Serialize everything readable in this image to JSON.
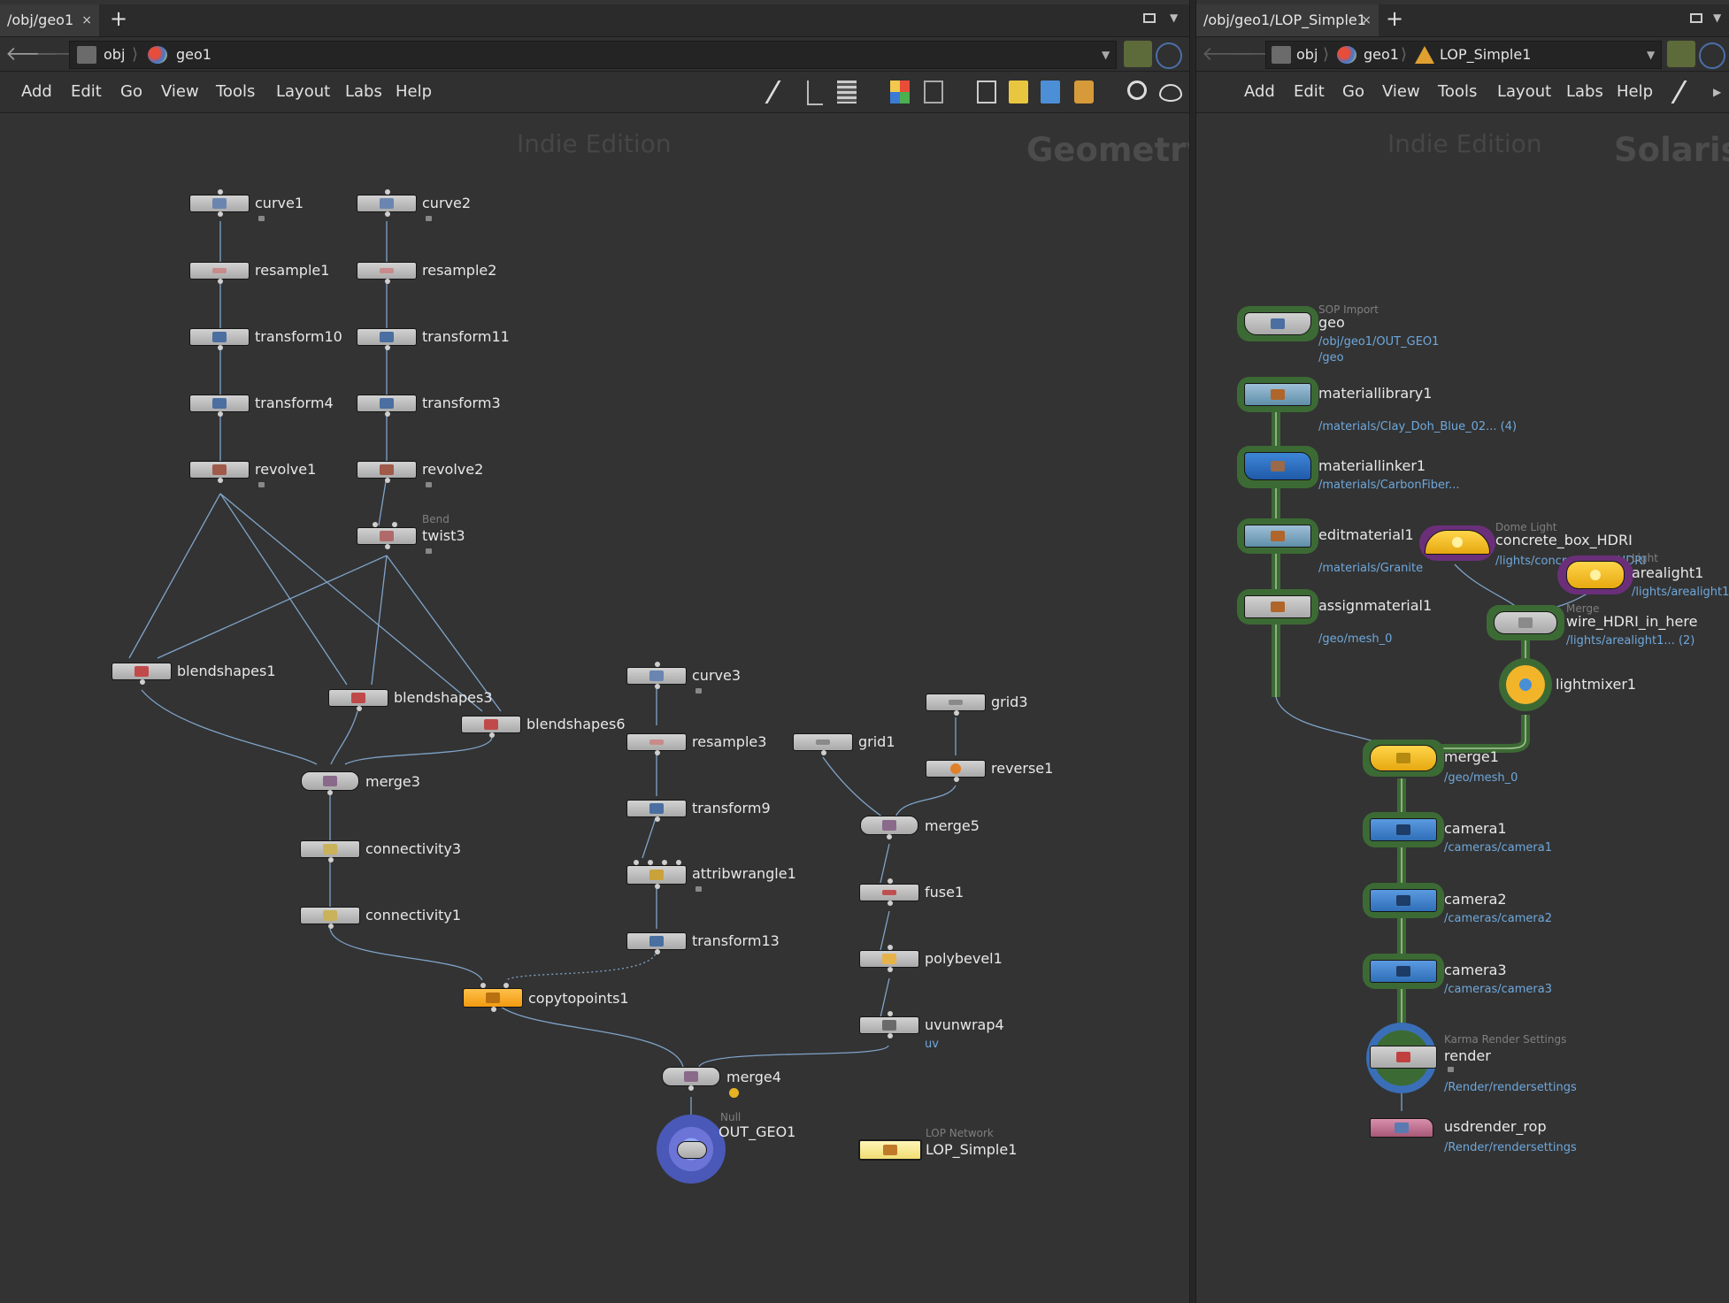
{
  "left_pane": {
    "tab_label": "/obj/geo1",
    "tab_close": "×",
    "tab_add": "+",
    "path": [
      "obj",
      "geo1"
    ],
    "menu": [
      "Add",
      "Edit",
      "Go",
      "View",
      "Tools",
      "Layout",
      "Labs",
      "Help"
    ],
    "watermark_edition": "Indie Edition",
    "watermark_context": "Geometry"
  },
  "right_pane": {
    "tab_label": "/obj/geo1/LOP_Simple1",
    "tab_close": "×",
    "tab_add": "+",
    "path": [
      "obj",
      "geo1",
      "LOP_Simple1"
    ],
    "menu": [
      "Add",
      "Edit",
      "Go",
      "View",
      "Tools",
      "Layout",
      "Labs",
      "Help"
    ],
    "watermark_edition": "Indie Edition",
    "watermark_context": "Solaris"
  },
  "icons": {
    "back": "back-arrow-icon",
    "forward": "forward-arrow-icon",
    "network": "network-icon",
    "geo": "geo-icon",
    "lop": "lop-network-icon"
  },
  "sop_nodes": [
    {
      "name": "curve1"
    },
    {
      "name": "curve2"
    },
    {
      "name": "resample1"
    },
    {
      "name": "resample2"
    },
    {
      "name": "transform10"
    },
    {
      "name": "transform11"
    },
    {
      "name": "transform4"
    },
    {
      "name": "transform3"
    },
    {
      "name": "revolve1"
    },
    {
      "name": "revolve2"
    },
    {
      "name": "twist3",
      "type": "Bend"
    },
    {
      "name": "blendshapes1"
    },
    {
      "name": "blendshapes3"
    },
    {
      "name": "blendshapes6"
    },
    {
      "name": "merge3"
    },
    {
      "name": "connectivity3"
    },
    {
      "name": "connectivity1"
    },
    {
      "name": "curve3"
    },
    {
      "name": "resample3"
    },
    {
      "name": "transform9"
    },
    {
      "name": "attribwrangle1"
    },
    {
      "name": "transform13"
    },
    {
      "name": "copytopoints1"
    },
    {
      "name": "grid1"
    },
    {
      "name": "grid3"
    },
    {
      "name": "reverse1"
    },
    {
      "name": "merge5"
    },
    {
      "name": "fuse1"
    },
    {
      "name": "polybevel1"
    },
    {
      "name": "uvunwrap4",
      "sub": "uv"
    },
    {
      "name": "merge4"
    },
    {
      "name": "OUT_GEO1",
      "type": "Null"
    },
    {
      "name": "LOP_Simple1",
      "type": "LOP Network"
    }
  ],
  "lop_nodes": [
    {
      "name": "geo",
      "type": "SOP Import",
      "path1": "/obj/geo1/OUT_GEO1",
      "path2": "/geo"
    },
    {
      "name": "materiallibrary1",
      "path1": "/materials/Clay_Doh_Blue_02... (4)"
    },
    {
      "name": "materiallinker1",
      "path1": "/materials/CarbonFiber..."
    },
    {
      "name": "concrete_box_HDRI",
      "type": "Dome Light",
      "path1": "/lights/concrete_box_HDRI"
    },
    {
      "name": "arealight1",
      "type": "Light",
      "path1": "/lights/arealight1"
    },
    {
      "name": "editmaterial1",
      "path1": "/materials/Granite"
    },
    {
      "name": "wire_HDRI_in_here",
      "type": "Merge",
      "path1": "/lights/arealight1... (2)"
    },
    {
      "name": "assignmaterial1",
      "path1": "/geo/mesh_0"
    },
    {
      "name": "lightmixer1"
    },
    {
      "name": "merge1",
      "path1": "/geo/mesh_0"
    },
    {
      "name": "camera1",
      "path1": "/cameras/camera1"
    },
    {
      "name": "camera2",
      "path1": "/cameras/camera2"
    },
    {
      "name": "camera3",
      "path1": "/cameras/camera3"
    },
    {
      "name": "render",
      "type": "Karma Render Settings",
      "path1": "/Render/rendersettings"
    },
    {
      "name": "usdrender_rop",
      "path1": "/Render/rendersettings"
    }
  ],
  "colors": {
    "pane_bg": "#333333",
    "wire": "#7fa3c8",
    "lop_wire": "#4f7f44",
    "copytopoints": "#f5a623",
    "out_null": "#5b6fc4",
    "lop_network": "#f3e48a",
    "light": "#e6b21c",
    "light_glow": "#6b2f7a",
    "camera": "#3a7bc0",
    "material": "#5f8ea8",
    "rop": "#b96a86",
    "path_text": "#6fa8dc"
  }
}
